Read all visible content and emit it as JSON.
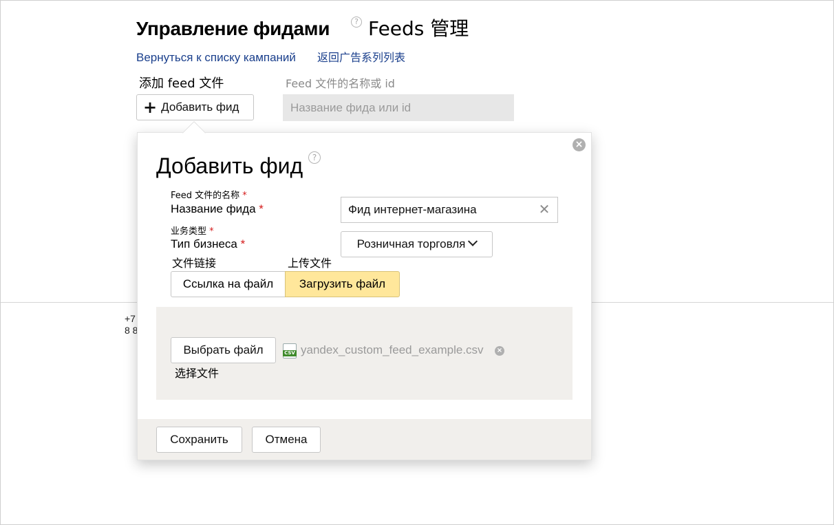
{
  "header": {
    "title": "Управление фидами",
    "title_cn": "Feeds 管理",
    "help_glyph": "?"
  },
  "links": {
    "back_ru": "Вернуться к списку кампаний",
    "back_cn": "返回广告系列列表"
  },
  "toolbar": {
    "add_label_cn": "添加 feed 文件",
    "add_button_icon": "+",
    "add_button_label": "Добавить фид",
    "search_label_cn": "Feed 文件的名称或 id",
    "search_placeholder": "Название фида или id"
  },
  "background": {
    "phone_line1": "+7",
    "phone_line2": "8 8"
  },
  "dialog": {
    "title": "Добавить фид",
    "help_glyph": "?",
    "close_glyph": "×",
    "name_label_cn": "Feed 文件的名称",
    "name_label": "Название фида",
    "name_value": "Фид интернет-магазина",
    "clear_glyph": "✕",
    "type_label_cn": "业务类型",
    "type_label": "Тип бизнеса",
    "type_value": "Розничная торговля",
    "required_mark": "*",
    "source_link_cn": "文件链接",
    "source_upload_cn": "上传文件",
    "source_link": "Ссылка на файл",
    "source_upload": "Загрузить файл",
    "choose_file": "Выбрать файл",
    "choose_file_cn": "选择文件",
    "file_badge": "CSV",
    "file_name": "yandex_custom_feed_example.csv",
    "remove_glyph": "×",
    "save": "Сохранить",
    "cancel": "Отмена"
  },
  "colors": {
    "link": "#1a3f8c",
    "active_segment": "#ffe79b",
    "required": "#d41a1a",
    "panel": "#f1efec"
  }
}
